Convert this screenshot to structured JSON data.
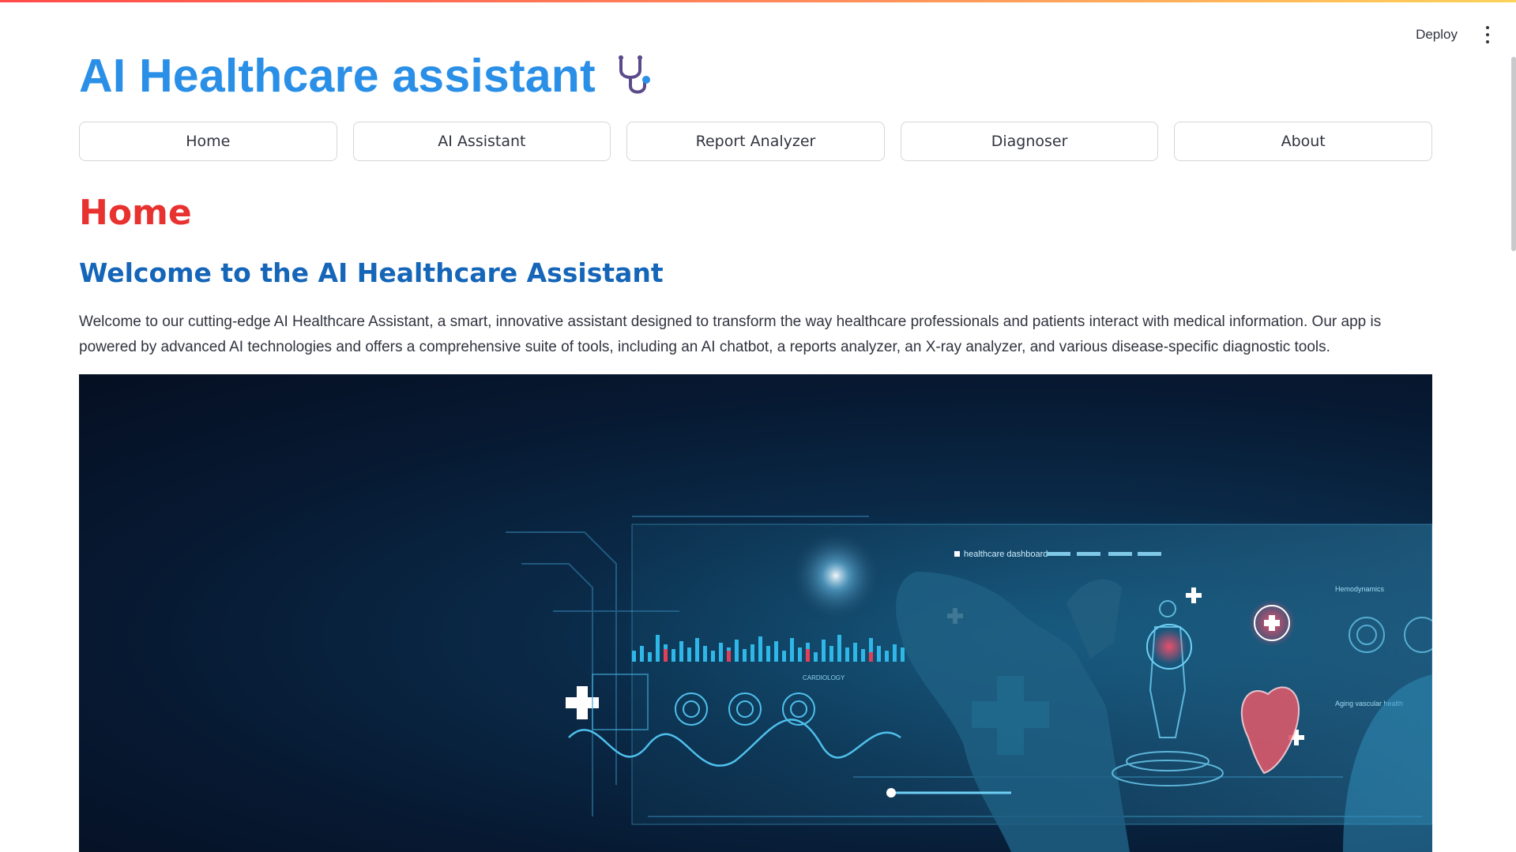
{
  "header": {
    "deploy_label": "Deploy",
    "menu_icon": "kebab-menu-icon"
  },
  "app": {
    "title": "AI Healthcare assistant",
    "title_icon": "stethoscope-icon",
    "title_color": "#2a8fe6"
  },
  "nav": {
    "items": [
      {
        "label": "Home"
      },
      {
        "label": "AI Assistant"
      },
      {
        "label": "Report Analyzer"
      },
      {
        "label": "Diagnoser"
      },
      {
        "label": "About"
      }
    ]
  },
  "page": {
    "heading": "Home",
    "heading_color": "#e8322f",
    "welcome_heading": "Welcome to the AI Healthcare Assistant",
    "welcome_color": "#1565b8",
    "intro": "Welcome to our cutting-edge AI Healthcare Assistant, a smart, innovative assistant designed to transform the way healthcare professionals and patients interact with medical information. Our app is powered by advanced AI technologies and offers a comprehensive suite of tools, including an AI chatbot, a reports analyzer, an X-ray analyzer, and various disease-specific diagnostic tools."
  },
  "hero": {
    "dashboard_label": "healthcare dashboard",
    "cardiology_label": "CARDIOLOGY",
    "hemodynamics_label": "Hemodynamics",
    "vascular_label": "Aging vascular health"
  }
}
